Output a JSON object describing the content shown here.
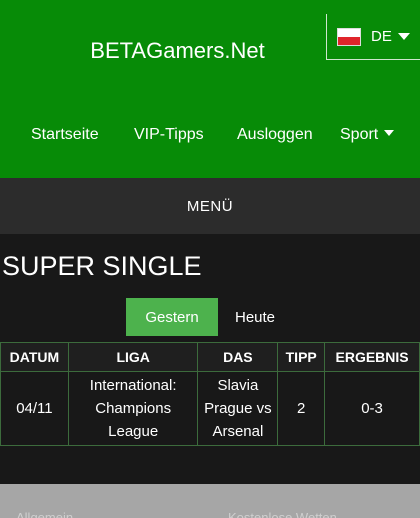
{
  "header": {
    "site_title": "BETAGamers.Net",
    "language": "DE",
    "colors": {
      "header_bg": "#078b07",
      "active_tab": "#4db24d"
    }
  },
  "nav": {
    "items": [
      {
        "label": "Startseite"
      },
      {
        "label": "VIP-Tipps"
      },
      {
        "label": "Ausloggen"
      },
      {
        "label": "Sport"
      }
    ]
  },
  "menu": {
    "label": "MENÜ"
  },
  "main": {
    "title": "SUPER SINGLE",
    "tabs": [
      {
        "label": "Gestern",
        "active": true
      },
      {
        "label": "Heute",
        "active": false
      }
    ],
    "table": {
      "headers": [
        "DATUM",
        "LIGA",
        "DAS",
        "TIPP",
        "ERGEBNIS"
      ],
      "rows": [
        {
          "datum": "04/11",
          "liga": "International: Champions League",
          "das": "Slavia Prague vs Arsenal",
          "tipp": "2",
          "ergebnis": "0-3"
        }
      ]
    }
  },
  "footer": {
    "left_label": "Allgemein",
    "right_label": "Kostenlose Wetten"
  }
}
